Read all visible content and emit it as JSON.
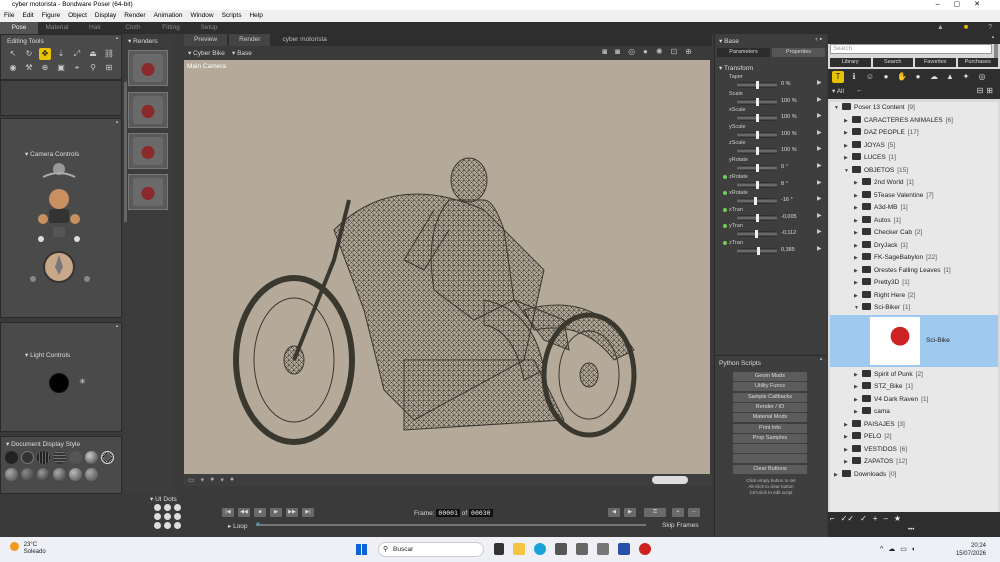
{
  "window": {
    "title": "cyber motorista - Bondware Poser (64-bit)"
  },
  "menu": [
    "File",
    "Edit",
    "Figure",
    "Object",
    "Display",
    "Render",
    "Animation",
    "Window",
    "Scripts",
    "Help"
  ],
  "rooms": [
    "Pose",
    "Material",
    "Hair",
    "Cloth",
    "Fitting",
    "Setup"
  ],
  "active_room": "Pose",
  "panels": {
    "editing_tools": "Editing Tools",
    "camera_controls": "Camera Controls",
    "light_controls": "Light Controls",
    "document_display_style": "Document Display Style",
    "renders": "Renders",
    "ui_dots": "UI Dots"
  },
  "viewport": {
    "tabs": [
      "Preview",
      "Render"
    ],
    "doc_name": "cyber motorista",
    "figure_select": "Cyber Bike",
    "actor_select": "Base",
    "camera_label": "Main Camera"
  },
  "animation": {
    "frame_label": "Frame:",
    "current_frame": "00001",
    "of_label": "of",
    "total_frames": "00030",
    "loop_label": "Loop",
    "skip_frames_label": "Skip Frames"
  },
  "parameters": {
    "actor": "Base",
    "tabs": [
      "Parameters",
      "Properties"
    ],
    "group": "Transform",
    "rows": [
      {
        "label": "Taper",
        "value": "0 %",
        "dot": false,
        "level": 0.5
      },
      {
        "label": "Scale",
        "value": "100 %",
        "dot": false,
        "level": 0.5
      },
      {
        "label": "xScale",
        "value": "100 %",
        "dot": false,
        "level": 0.5
      },
      {
        "label": "yScale",
        "value": "100 %",
        "dot": false,
        "level": 0.5
      },
      {
        "label": "zScale",
        "value": "100 %",
        "dot": false,
        "level": 0.5
      },
      {
        "label": "yRotate",
        "value": "0 °",
        "dot": false,
        "level": 0.5
      },
      {
        "label": "zRotate",
        "value": "8 °",
        "dot": true,
        "level": 0.52
      },
      {
        "label": "xRotate",
        "value": "-16 °",
        "dot": true,
        "level": 0.46
      },
      {
        "label": "xTran",
        "value": "-0,005",
        "dot": true,
        "level": 0.5
      },
      {
        "label": "yTran",
        "value": "-0,112",
        "dot": true,
        "level": 0.48
      },
      {
        "label": "zTran",
        "value": "0,385",
        "dot": true,
        "level": 0.55
      }
    ]
  },
  "python_scripts": {
    "title": "Python Scripts",
    "buttons": [
      "Geom Mods",
      "Utility Funcs",
      "Sample Callbacks",
      "Render / IO",
      "Material Mods",
      "Print Info",
      "Prop Samples",
      "",
      "",
      "Clear Buttons"
    ],
    "help": [
      "Click empty button to set",
      "Alt-click to clear button",
      "Ctrl-click to edit script"
    ]
  },
  "library": {
    "search_placeholder": "Search",
    "tabs": [
      "Library",
      "Search",
      "Favorites",
      "Purchases"
    ],
    "filter": "All",
    "tree": [
      {
        "label": "Poser 13 Content",
        "count": "[9]",
        "depth": 0,
        "open": true
      },
      {
        "label": "CARACTERES ANIMALES",
        "count": "[6]",
        "depth": 1,
        "open": false
      },
      {
        "label": "DAZ PEOPLE",
        "count": "[17]",
        "depth": 1,
        "open": false
      },
      {
        "label": "JOYAS",
        "count": "[5]",
        "depth": 1,
        "open": false
      },
      {
        "label": "LUCES",
        "count": "[1]",
        "depth": 1,
        "open": false
      },
      {
        "label": "OBJETOS",
        "count": "[15]",
        "depth": 1,
        "open": true
      },
      {
        "label": "2nd World",
        "count": "[1]",
        "depth": 2,
        "open": false
      },
      {
        "label": "5Tease Valentine",
        "count": "[7]",
        "depth": 2,
        "open": false
      },
      {
        "label": "A3d-MB",
        "count": "[1]",
        "depth": 2,
        "open": false
      },
      {
        "label": "Autos",
        "count": "[1]",
        "depth": 2,
        "open": false
      },
      {
        "label": "Checker Cab",
        "count": "[2]",
        "depth": 2,
        "open": false
      },
      {
        "label": "DryJack",
        "count": "[1]",
        "depth": 2,
        "open": false
      },
      {
        "label": "FK-SageBabylon",
        "count": "[22]",
        "depth": 2,
        "open": false
      },
      {
        "label": "Orestes Falling Leaves",
        "count": "[1]",
        "depth": 2,
        "open": false
      },
      {
        "label": "Pretty3D",
        "count": "[1]",
        "depth": 2,
        "open": false
      },
      {
        "label": "Right Here",
        "count": "[2]",
        "depth": 2,
        "open": false
      },
      {
        "label": "Sci-Biker",
        "count": "[1]",
        "depth": 2,
        "open": true
      }
    ],
    "selected_item": "Sci-Bike",
    "tree_after": [
      {
        "label": "Spirit of Punk",
        "count": "[2]",
        "depth": 2
      },
      {
        "label": "STZ_Bike",
        "count": "[1]",
        "depth": 2
      },
      {
        "label": "V4 Dark Raven",
        "count": "[1]",
        "depth": 2
      },
      {
        "label": "cama",
        "count": "",
        "depth": 2
      },
      {
        "label": "PAISAJES",
        "count": "[3]",
        "depth": 1
      },
      {
        "label": "PELO",
        "count": "[2]",
        "depth": 1
      },
      {
        "label": "VESTIDOS",
        "count": "[6]",
        "depth": 1
      },
      {
        "label": "ZAPATOS",
        "count": "[12]",
        "depth": 1
      },
      {
        "label": "Downloads",
        "count": "[0]",
        "depth": 0
      }
    ]
  },
  "taskbar": {
    "temperature": "23°C",
    "weather": "Soleado",
    "search_placeholder": "Buscar",
    "time": "20:24",
    "date": "15/07/2026"
  }
}
